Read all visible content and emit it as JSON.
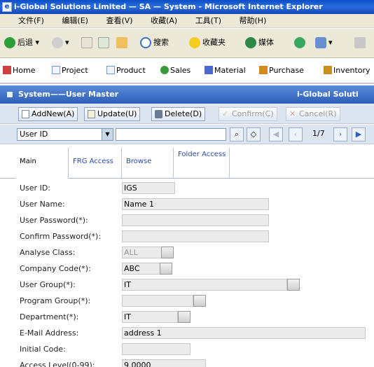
{
  "window": {
    "title": "i-Global Solutions Limited — SA — System - Microsoft Internet Explorer"
  },
  "menu": [
    "文件(F)",
    "编辑(E)",
    "查看(V)",
    "收藏(A)",
    "工具(T)",
    "帮助(H)"
  ],
  "ie_toolbar": {
    "back": "后退",
    "search": "搜索",
    "favorites": "收藏夹",
    "media": "媒体"
  },
  "links": [
    "Home",
    "Project",
    "Product",
    "Sales",
    "Material",
    "Purchase",
    "Inventory"
  ],
  "module": {
    "left": "System——User Master",
    "right": "i-Global Soluti"
  },
  "actions": {
    "addnew": "AddNew(A)",
    "update": "Update(U)",
    "delete": "Delete(D)",
    "confirm": "Confirm(C)",
    "cancel": "Cancel(R)"
  },
  "search": {
    "field": "User ID",
    "page": "1/7"
  },
  "tabs": [
    "Main",
    "FRG Access",
    "Browse",
    "Folder Access"
  ],
  "form": {
    "user_id": {
      "label": "User ID:",
      "value": "IGS"
    },
    "user_name": {
      "label": "User Name:",
      "value": "Name 1"
    },
    "password": {
      "label": "User Password(*):",
      "value": ""
    },
    "confirm_password": {
      "label": "Confirm Password(*):",
      "value": ""
    },
    "analyse_class": {
      "label": "Analyse Class:",
      "value": "ALL"
    },
    "company_code": {
      "label": "Company Code(*):",
      "value": "ABC"
    },
    "user_group": {
      "label": "User Group(*):",
      "value": "IT"
    },
    "program_group": {
      "label": "Program Group(*):",
      "value": ""
    },
    "department": {
      "label": "Department(*):",
      "value": "IT"
    },
    "email": {
      "label": "E-Mail Address:",
      "value": "address 1"
    },
    "initial_code": {
      "label": "Initial Code:",
      "value": ""
    },
    "access_level": {
      "label": "Access Level(0-99):",
      "value": "9.0000"
    }
  }
}
